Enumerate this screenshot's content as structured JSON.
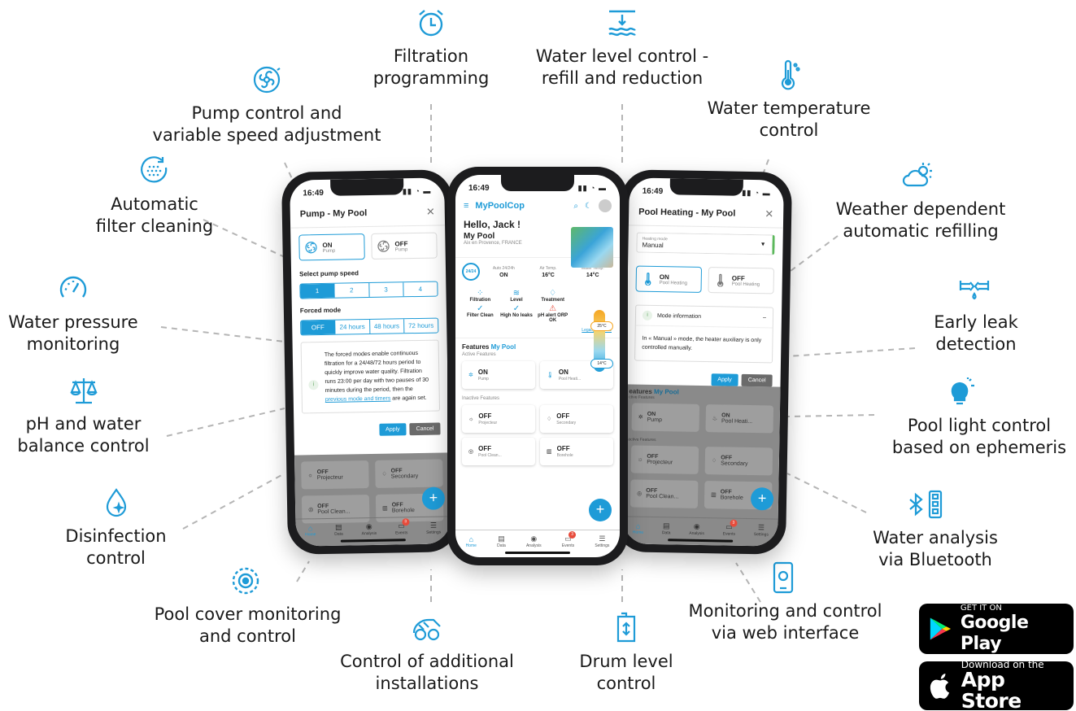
{
  "features": [
    {
      "id": "filtration",
      "icon": "alarm-clock-icon",
      "label": "Filtration\nprogramming"
    },
    {
      "id": "water-level",
      "icon": "water-level-icon",
      "label": "Water level control -\nrefill and reduction"
    },
    {
      "id": "pump",
      "icon": "pump-fan-icon",
      "label": "Pump control and\nvariable speed adjustment"
    },
    {
      "id": "temperature",
      "icon": "thermometer-icon",
      "label": "Water temperature\ncontrol"
    },
    {
      "id": "filter-cleaning",
      "icon": "filter-cleaning-icon",
      "label": "Automatic\nfilter cleaning"
    },
    {
      "id": "weather",
      "icon": "weather-icon",
      "label": "Weather dependent\nautomatic refilling"
    },
    {
      "id": "pressure",
      "icon": "pressure-gauge-icon",
      "label": "Water pressure\nmonitoring"
    },
    {
      "id": "leak",
      "icon": "pipe-leak-icon",
      "label": "Early leak\ndetection"
    },
    {
      "id": "ph",
      "icon": "balance-scale-icon",
      "label": "pH and water\nbalance control"
    },
    {
      "id": "light",
      "icon": "light-bulb-icon",
      "label": "Pool light control\nbased on ephemeris"
    },
    {
      "id": "disinfection",
      "icon": "droplet-sparkle-icon",
      "label": "Disinfection\ncontrol"
    },
    {
      "id": "bluetooth",
      "icon": "bluetooth-icon",
      "label": "Water analysis\nvia Bluetooth"
    },
    {
      "id": "cover",
      "icon": "pool-cover-icon",
      "label": "Pool cover monitoring\nand control"
    },
    {
      "id": "web",
      "icon": "web-device-icon",
      "label": "Monitoring and control\nvia web interface"
    },
    {
      "id": "installations",
      "icon": "robot-cleaner-icon",
      "label": "Control of additional\ninstallations"
    },
    {
      "id": "drum",
      "icon": "drum-icon",
      "label": "Drum level\ncontrol"
    }
  ],
  "status_time": "16:49",
  "phone_left": {
    "title": "Pump - My Pool",
    "tiles": [
      {
        "state": "ON",
        "name": "Pump"
      },
      {
        "state": "OFF",
        "name": "Pump"
      }
    ],
    "speed_label": "Select pump speed",
    "speeds": [
      "1",
      "2",
      "3",
      "4"
    ],
    "forced_label": "Forced mode",
    "forced": [
      "OFF",
      "24 hours",
      "48 hours",
      "72 hours"
    ],
    "info_text": "The forced modes enable continuous filtration for a 24/48/72 hours period to quickly improve water quality. Filtration runs 23:00 per day with two pauses of 30 minutes during the period, then the ",
    "info_link": "previous mode and timers",
    "info_tail": " are again set.",
    "apply": "Apply",
    "cancel": "Cancel",
    "bg_tiles": [
      {
        "state": "OFF",
        "name": "Projecteur"
      },
      {
        "state": "OFF",
        "name": "Secondary"
      },
      {
        "state": "OFF",
        "name": "Pool Clean..."
      },
      {
        "state": "OFF",
        "name": "Borehole"
      }
    ],
    "tabs": [
      "Home",
      "Data",
      "Analysis",
      "Events",
      "Settings"
    ],
    "event_badge": "3"
  },
  "phone_center": {
    "brand": "MyPoolCop",
    "greeting": "Hello, Jack !",
    "pool_name": "My Pool",
    "pool_location": "Aix en Provence, FRANCE",
    "mode_badge": "24/24",
    "stats": [
      {
        "label": "Auto 24/24h",
        "value": "ON"
      },
      {
        "label": "Air Temp.",
        "value": "16°C"
      },
      {
        "label": "Water Temp.",
        "value": "14°C"
      }
    ],
    "checks": [
      {
        "title": "Filtration",
        "status": "Filter Clean"
      },
      {
        "title": "Level",
        "status": "High No leaks"
      },
      {
        "title": "Treatment",
        "status": "pH alert ORP OK"
      }
    ],
    "gauge_high": "25°C",
    "gauge_low": "14°C",
    "legacy_link": "Legacy interface",
    "features_title": "Features",
    "features_pool": "My Pool",
    "active_label": "Active Features",
    "active": [
      {
        "state": "ON",
        "name": "Pump"
      },
      {
        "state": "ON",
        "name": "Pool Heati..."
      }
    ],
    "inactive_label": "Inactive Features",
    "inactive": [
      {
        "state": "OFF",
        "name": "Projecteur"
      },
      {
        "state": "OFF",
        "name": "Secondary"
      },
      {
        "state": "OFF",
        "name": "Pool Clean..."
      },
      {
        "state": "OFF",
        "name": "Borehole"
      }
    ],
    "tabs": [
      "Home",
      "Data",
      "Analysis",
      "Events",
      "Settings"
    ],
    "event_badge": "3"
  },
  "phone_right": {
    "title": "Pool Heating - My Pool",
    "mode_label": "Heating mode",
    "mode_value": "Manual",
    "tiles": [
      {
        "state": "ON",
        "name": "Pool Heating"
      },
      {
        "state": "OFF",
        "name": "Pool Heating"
      }
    ],
    "accordion_title": "Mode information",
    "accordion_body": "In « Manual » mode, the heater auxiliary is only controlled manually.",
    "apply": "Apply",
    "cancel": "Cancel",
    "features_title": "eatures",
    "features_pool": "My Pool",
    "active_label": "ctive Features",
    "active": [
      {
        "state": "ON",
        "name": "Pump"
      },
      {
        "state": "ON",
        "name": "Pool Heati..."
      }
    ],
    "inactive_label": "active Features",
    "inactive": [
      {
        "state": "OFF",
        "name": "Projecteur"
      },
      {
        "state": "OFF",
        "name": "Secondary"
      },
      {
        "state": "OFF",
        "name": "Pool Clean..."
      },
      {
        "state": "OFF",
        "name": "Borehole"
      }
    ],
    "tabs": [
      "Home",
      "Data",
      "Analysis",
      "Events",
      "Settings"
    ],
    "event_badge": "3"
  },
  "stores": {
    "google_small": "GET IT ON",
    "google_big": "Google Play",
    "apple_small": "Download on the",
    "apple_big": "App Store"
  },
  "colors": {
    "accent": "#1e9bd7",
    "text": "#1a1a1a",
    "dim": "#8a8a8a"
  }
}
